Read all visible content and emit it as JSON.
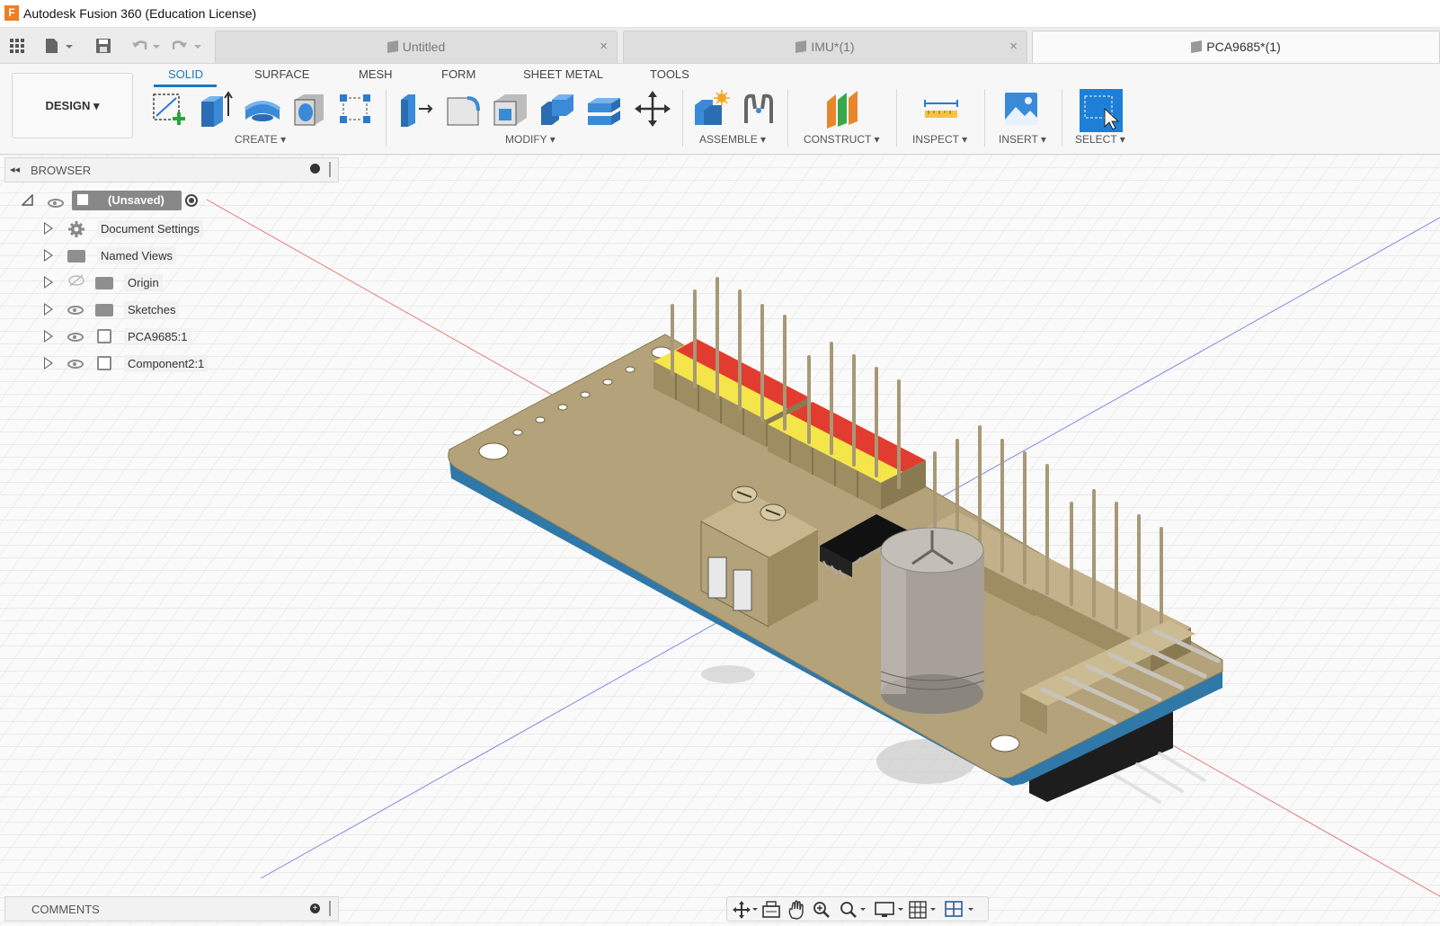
{
  "window": {
    "title": "Autodesk Fusion 360 (Education License)",
    "logo": "F"
  },
  "tabs": [
    {
      "label": "Untitled",
      "close": "×"
    },
    {
      "label": "IMU*(1)",
      "close": "×"
    },
    {
      "label": "PCA9685*(1)"
    }
  ],
  "ribbon": {
    "workspace": "DESIGN ▾",
    "tabs": [
      "SOLID",
      "SURFACE",
      "MESH",
      "FORM",
      "SHEET METAL",
      "TOOLS"
    ],
    "active_tab": "SOLID",
    "groups": [
      "CREATE ▾",
      "MODIFY ▾",
      "ASSEMBLE ▾",
      "CONSTRUCT ▾",
      "INSPECT ▾",
      "INSERT ▾",
      "SELECT ▾"
    ]
  },
  "browser": {
    "title": "BROWSER",
    "root": "(Unsaved)",
    "items": [
      "Document Settings",
      "Named Views",
      "Origin",
      "Sketches",
      "PCA9685:1",
      "Component2:1"
    ]
  },
  "comments": {
    "title": "COMMENTS"
  },
  "colors": {
    "accent": "#1a78c2",
    "board": "#b3a27a",
    "board_edge": "#3d7fab",
    "header_yellow": "#f4e64a",
    "header_red": "#e23c30",
    "x_axis": "#e87a7a",
    "z_axis": "#7d8be0"
  }
}
